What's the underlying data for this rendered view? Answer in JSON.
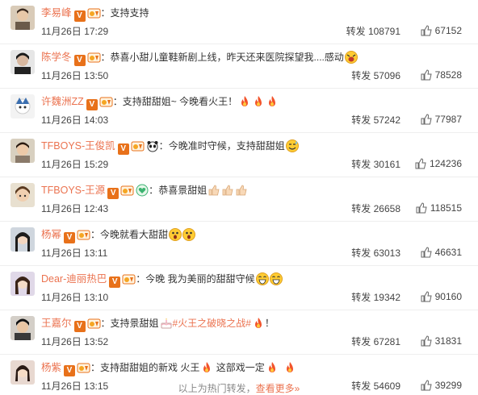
{
  "labels": {
    "repost": "转发 "
  },
  "comments": [
    {
      "name": "李易峰",
      "vip": true,
      "extra": null,
      "text": "支持支持",
      "emoji": [],
      "date": "11月26日 17:29",
      "reposts": "108791",
      "likes": "67152"
    },
    {
      "name": "陈学冬",
      "vip": true,
      "extra": null,
      "text": "恭喜小甜儿童鞋新剧上线，昨天还来医院探望我....感动",
      "emoji": [
        "cry"
      ],
      "date": "11月26日 13:50",
      "reposts": "57096",
      "likes": "78528"
    },
    {
      "name": "许魏洲ZZ",
      "vip": true,
      "extra": null,
      "text": "支持甜甜姐~ 今晚看火王！",
      "emoji": [
        "fire",
        "fire",
        "fire"
      ],
      "date": "11月26日 14:03",
      "reposts": "57242",
      "likes": "77987"
    },
    {
      "name": "TFBOYS-王俊凯",
      "vip": true,
      "extra": "panda",
      "text": "今晚准时守候，支持甜甜姐",
      "emoji": [
        "sweat"
      ],
      "date": "11月26日 15:29",
      "reposts": "30161",
      "likes": "124236"
    },
    {
      "name": "TFBOYS-王源",
      "vip": true,
      "extra": "green",
      "text": "恭喜景甜姐",
      "emoji": [
        "thumb",
        "thumb",
        "thumb"
      ],
      "date": "11月26日 12:43",
      "reposts": "26658",
      "likes": "118515"
    },
    {
      "name": "杨幂",
      "vip": true,
      "extra": null,
      "text": "今晚就看大甜甜",
      "emoji": [
        "shock",
        "shock"
      ],
      "date": "11月26日 13:11",
      "reposts": "63013",
      "likes": "46631"
    },
    {
      "name": "Dear-迪丽热巴",
      "vip": true,
      "extra": null,
      "text": "今晚 我为美丽的甜甜守候",
      "emoji": [
        "laugh",
        "laugh"
      ],
      "date": "11月26日 13:10",
      "reposts": "19342",
      "likes": "90160"
    },
    {
      "name": "王嘉尔",
      "vip": true,
      "extra": null,
      "text": "支持景甜姐",
      "topic": "#火王之破晓之战#",
      "tail": "！",
      "emoji": [
        "cake"
      ],
      "emoji_after": [
        "fire"
      ],
      "date": "11月26日 13:52",
      "reposts": "67281",
      "likes": "31831"
    },
    {
      "name": "杨紫",
      "vip": true,
      "extra": null,
      "text": "支持甜甜姐的新戏 火王",
      "text2": " 这部戏一定",
      "emoji": [
        "fire"
      ],
      "emoji2": [
        "fire",
        "fire"
      ],
      "date": "11月26日 13:15",
      "reposts": "54609",
      "likes": "39299"
    }
  ],
  "footer": {
    "text": "以上为热门转发，",
    "more": "查看更多»"
  },
  "colors": {
    "name": "#eb7350",
    "vbadge": "#e8711a",
    "divider": "#eeeeee"
  }
}
